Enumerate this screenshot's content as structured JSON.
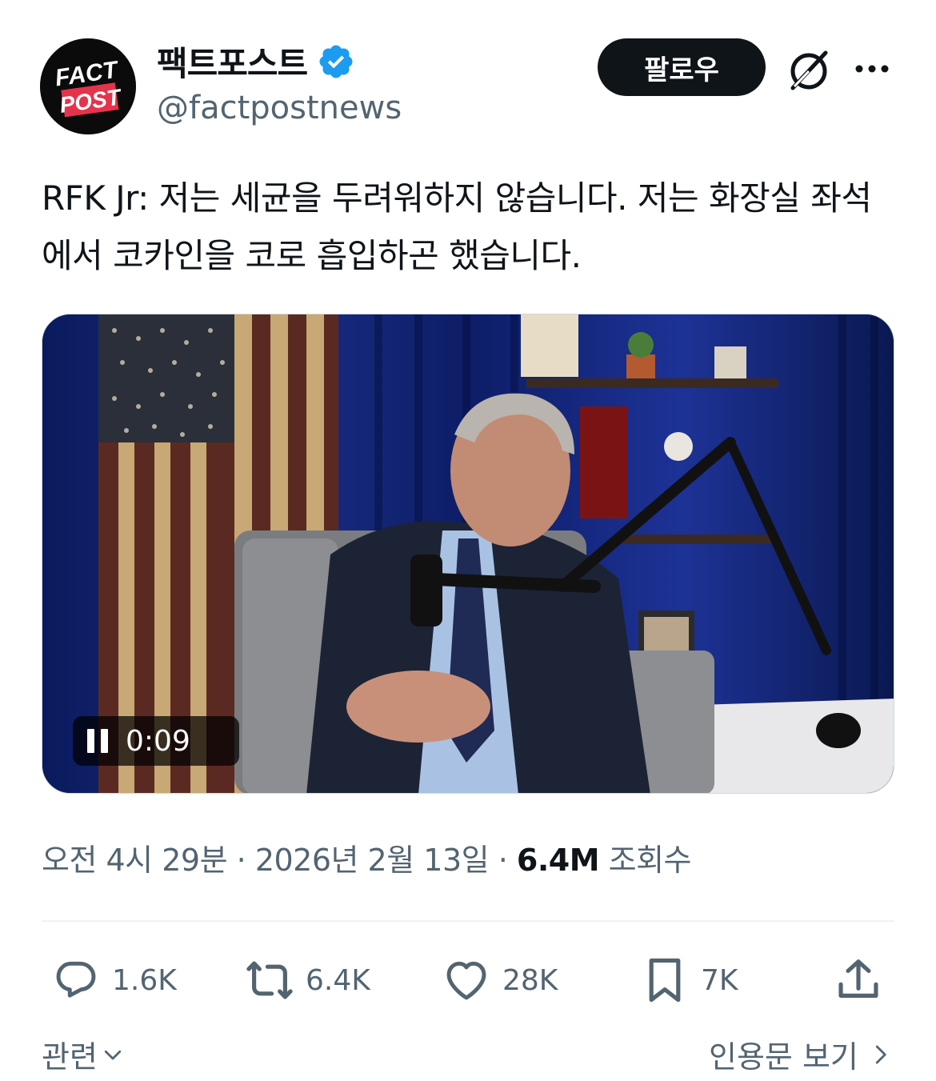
{
  "account": {
    "display_name": "팩트포스트",
    "handle": "@factpostnews",
    "avatar_text": [
      "FACT",
      "POST"
    ]
  },
  "header": {
    "follow_label": "팔로우"
  },
  "post": {
    "text": "RFK Jr: 저는 세균을 두려워하지 않습니다. 저는 화장실 좌석에서 코카인을 코로 흡입하곤 했습니다."
  },
  "video": {
    "timestamp": "0:09"
  },
  "meta": {
    "time": "오전 4시 29분",
    "separator": "·",
    "date": "2026년 2월 13일",
    "views_count": "6.4M",
    "views_label": "조회수"
  },
  "actions": {
    "replies": "1.6K",
    "reposts": "6.4K",
    "likes": "28K",
    "bookmarks": "7K"
  },
  "footer": {
    "related_label": "관련",
    "quotes_label": "인용문 보기"
  },
  "colors": {
    "verified": "#1d9bf0",
    "text": "#0f1419",
    "secondary": "#536471"
  }
}
